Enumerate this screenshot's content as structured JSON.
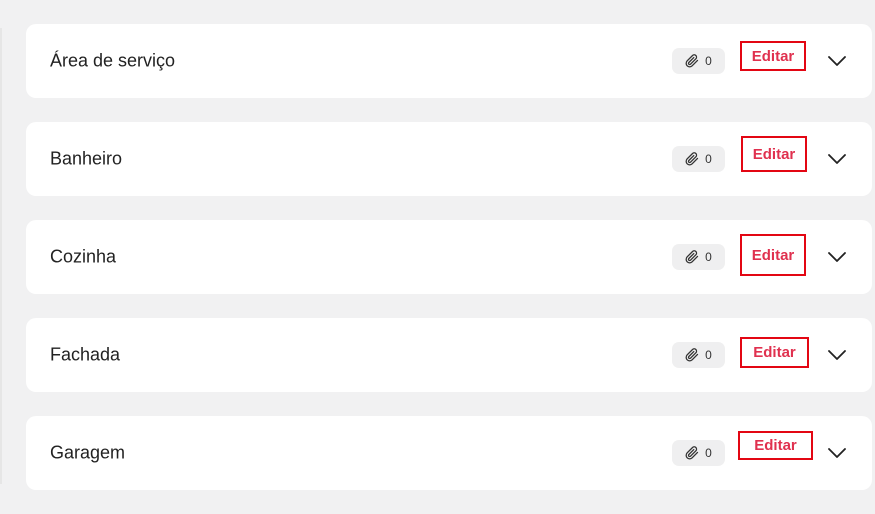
{
  "rooms": [
    {
      "name": "Área de serviço",
      "attachments": "0",
      "edit_label": "Editar"
    },
    {
      "name": "Banheiro",
      "attachments": "0",
      "edit_label": "Editar"
    },
    {
      "name": "Cozinha",
      "attachments": "0",
      "edit_label": "Editar"
    },
    {
      "name": "Fachada",
      "attachments": "0",
      "edit_label": "Editar"
    },
    {
      "name": "Garagem",
      "attachments": "0",
      "edit_label": "Editar"
    }
  ],
  "icons": {
    "attachment": "paperclip-icon",
    "expand": "chevron-down-icon"
  },
  "colors": {
    "page_background": "#f1f1f2",
    "card_background": "#ffffff",
    "edit_text": "#e0314f",
    "edit_highlight_border": "#e30613"
  }
}
